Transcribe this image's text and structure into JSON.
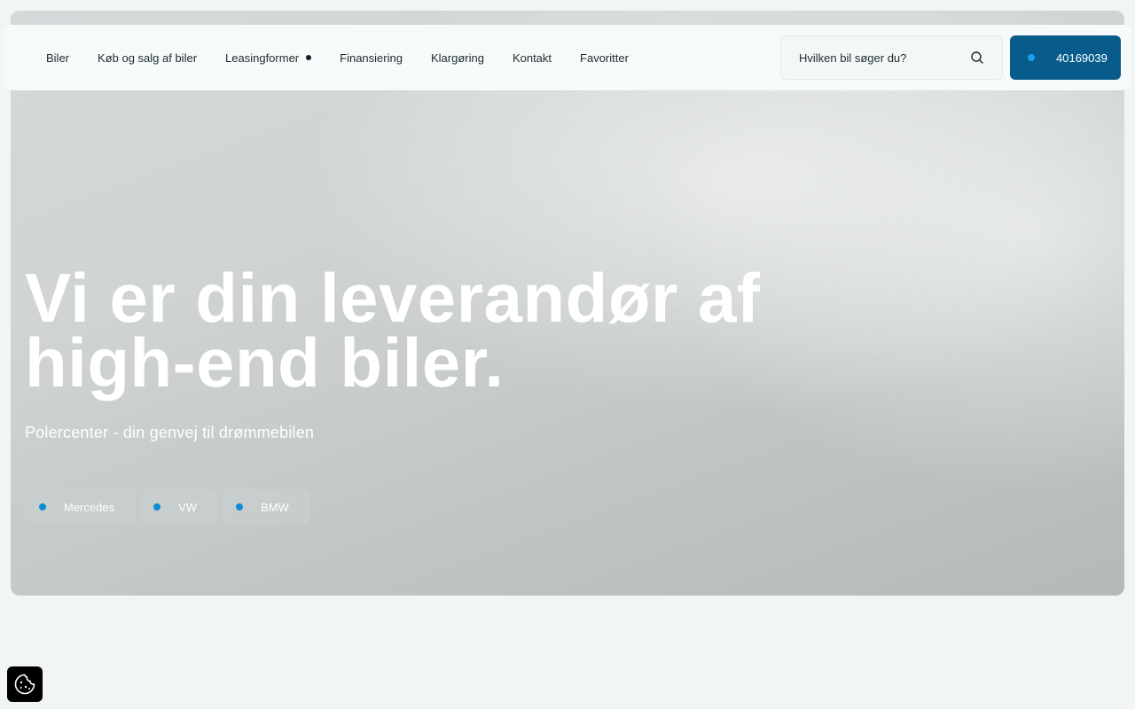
{
  "nav": {
    "items": [
      {
        "label": "Biler"
      },
      {
        "label": "Køb og salg af biler"
      },
      {
        "label": "Leasingformer",
        "has_submenu_dot": true
      },
      {
        "label": "Finansiering"
      },
      {
        "label": "Klargøring"
      },
      {
        "label": "Kontakt"
      },
      {
        "label": "Favoritter"
      }
    ]
  },
  "search": {
    "placeholder": "Hvilken bil søger du?",
    "icon": "search-icon"
  },
  "phone": {
    "label": "40169039",
    "accent": "#075c8c"
  },
  "hero": {
    "title_line1": "Vi er din leverandør af",
    "title_line2": "high-end biler.",
    "subtitle": "Polercenter - din genvej til drømmebilen",
    "brands": [
      {
        "label": "Mercedes"
      },
      {
        "label": "VW"
      },
      {
        "label": "BMW"
      }
    ],
    "dot_color": "#0a8fd6"
  },
  "cookie": {
    "icon": "cookie-icon"
  }
}
